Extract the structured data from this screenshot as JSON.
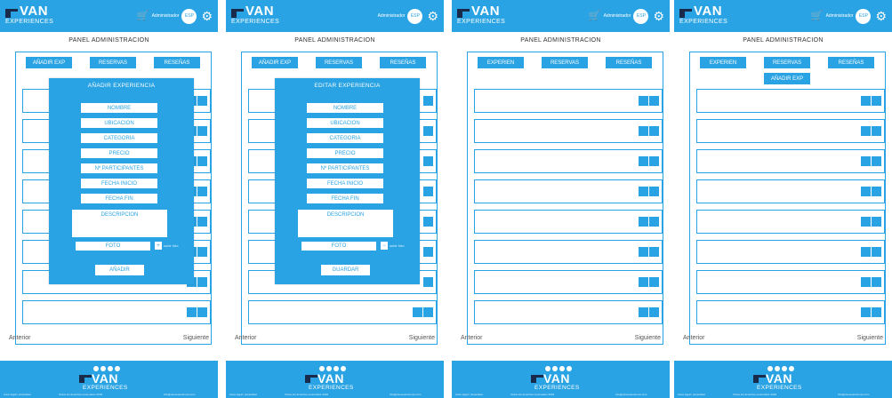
{
  "colors": {
    "accent": "#29a3e3",
    "background": "#ffffff"
  },
  "brand": {
    "name": "VAN",
    "tagline": "EXPERIENCES"
  },
  "icons": {
    "cart": "cart-icon",
    "gear": "gear-icon",
    "flag": "flag-icon"
  },
  "panel_title": "PANEL ADMINISTRACION",
  "nav": {
    "prev": "Anterior",
    "next": "Siguiente"
  },
  "panels": [
    {
      "header": {
        "user": "Administrador",
        "lang": "ESP"
      },
      "tabs": [
        "AÑADIR EXP",
        "RESERVAS",
        "RESEÑAS"
      ],
      "modal": {
        "title": "AÑADIR EXPERIENCIA",
        "fields": [
          "NOMBRE",
          "UBICACION",
          "CATEGORIA",
          "PRECIO",
          "Nº PARTICIPANTES",
          "FECHA INICIO",
          "FECHA FIN"
        ],
        "description": "DESCRIPCION",
        "image": "FOTO",
        "image_button": "+",
        "image_label": "subir foto",
        "submit": "AÑADIR"
      }
    },
    {
      "header": {
        "user": "Administrador",
        "lang": "ESP"
      },
      "tabs": [
        "AÑADIR EXP",
        "RESERVAS",
        "RESEÑAS"
      ],
      "modal": {
        "title": "EDITAR EXPERIENCIA",
        "fields": [
          "NOMBRE",
          "UBICACION",
          "CATEGORIA",
          "PRECIO",
          "Nº PARTICIPANTES",
          "FECHA INICIO",
          "FECHA FIN"
        ],
        "description": "DESCRIPCION",
        "image": "FOTO",
        "image_button": "−",
        "image_label": "subir foto",
        "submit": "GUARDAR"
      }
    },
    {
      "header": {
        "user": "Administrador",
        "lang": "ESP"
      },
      "tabs": [
        "EXPERIEN",
        "RESERVAS",
        "RESEÑAS"
      ]
    },
    {
      "header": {
        "user": "Administrador",
        "lang": "ESP"
      },
      "tabs": [
        "EXPERIEN",
        "RESERVAS",
        "RESEÑAS",
        "AÑADIR EXP"
      ]
    }
  ],
  "footer": {
    "links": [
      "Aviso legal / privacidad",
      "Todos los derechos reservados 2018",
      "info@vanexperiences.com"
    ]
  }
}
